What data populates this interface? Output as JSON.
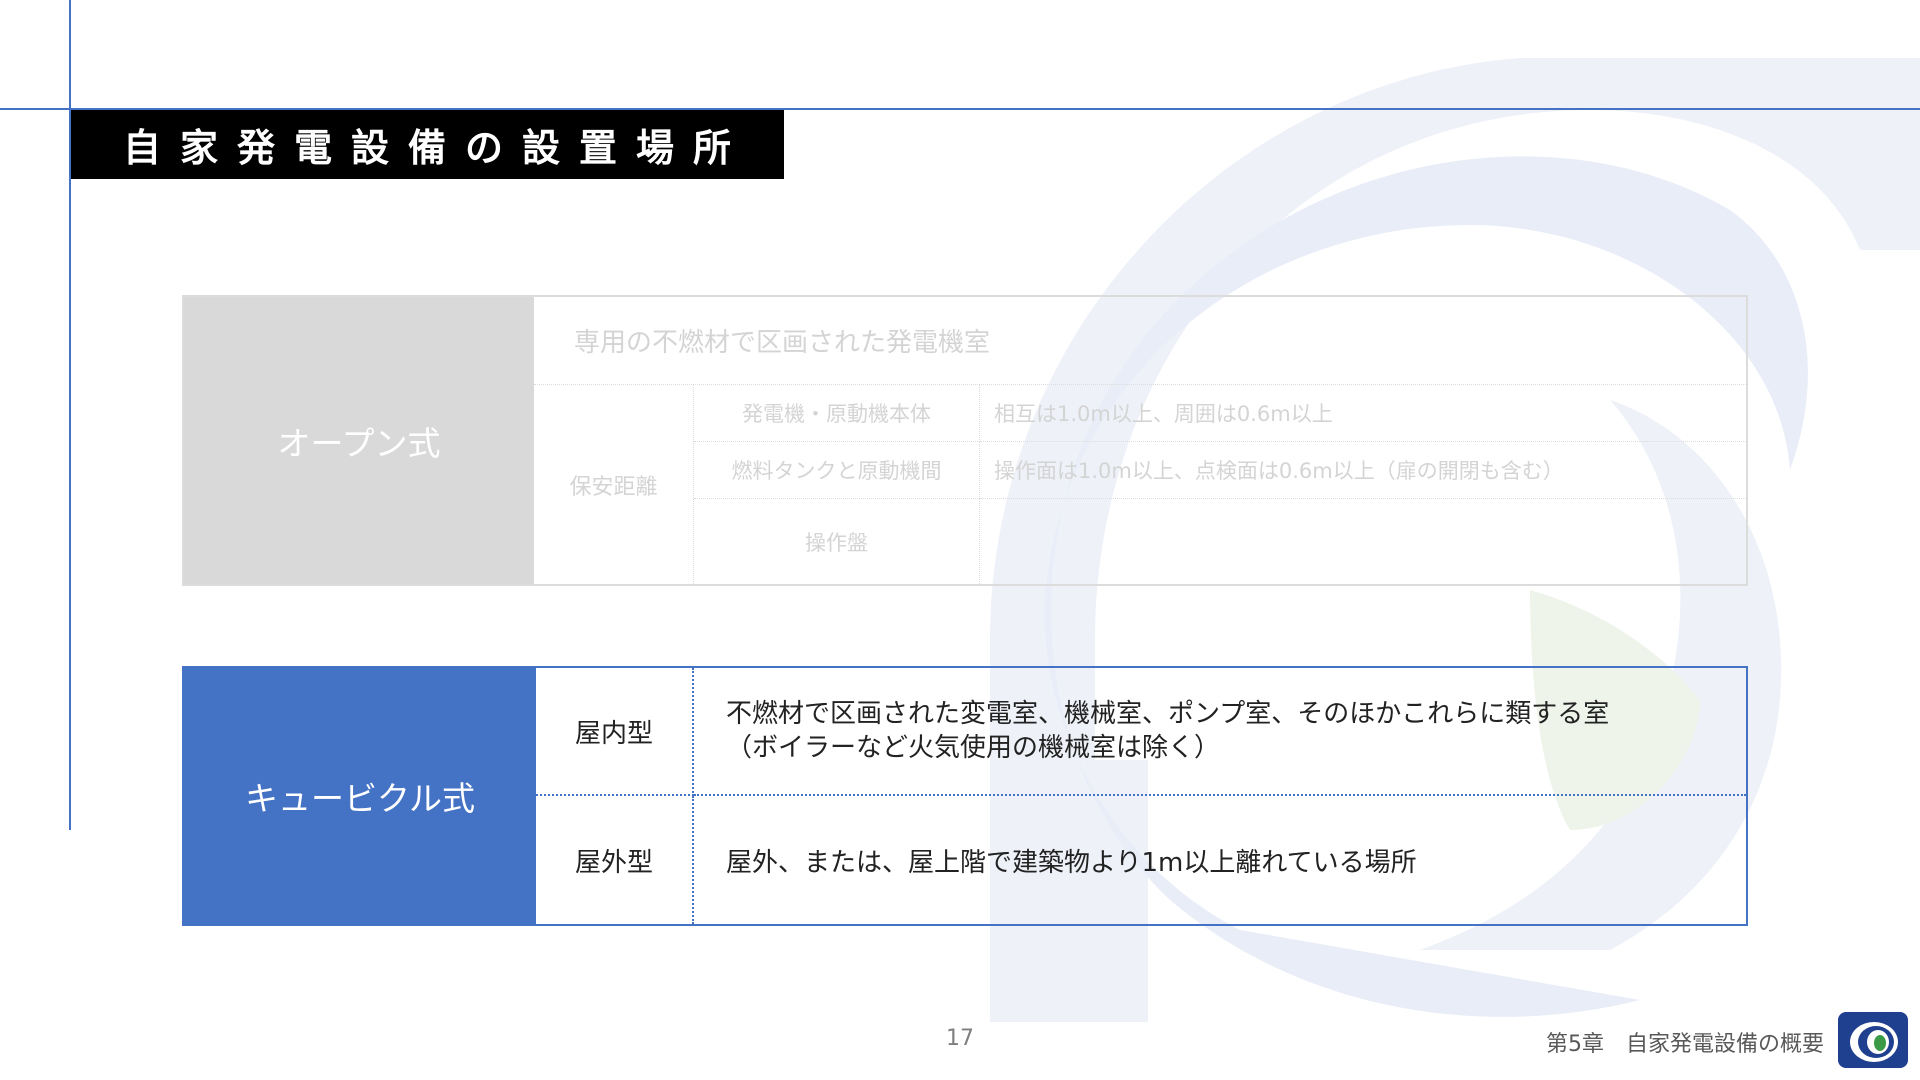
{
  "slide": {
    "title": "自家発電設備の設置場所",
    "page_number": "17",
    "footer": "第5章　自家発電設備の概要"
  },
  "open_type": {
    "category": "オープン式",
    "room": "専用の不燃材で区画された発電機室",
    "clearance_label": "保安距離",
    "rows": [
      {
        "item": "発電機・原動機本体",
        "value": "相互は1.0m以上、周囲は0.6m以上"
      },
      {
        "item": "燃料タンクと原動機間",
        "value": "操作面は1.0m以上、点検面は0.6m以上（扉の開閉も含む）"
      },
      {
        "item": "操作盤",
        "value": ""
      }
    ]
  },
  "cubicle_type": {
    "category": "キュービクル式",
    "rows": [
      {
        "type": "屋内型",
        "line1": "不燃材で区画された変電室、機械室、ポンプ室、そのほかこれらに類する室",
        "line2": "（ボイラーなど火気使用の機械室は除く）"
      },
      {
        "type": "屋外型",
        "line1": "屋外、または、屋上階で建築物より1m以上離れている場所"
      }
    ]
  },
  "colors": {
    "accent": "#4472c4",
    "title_bg": "#000000",
    "open_category_bg": "#d9d9d9"
  }
}
